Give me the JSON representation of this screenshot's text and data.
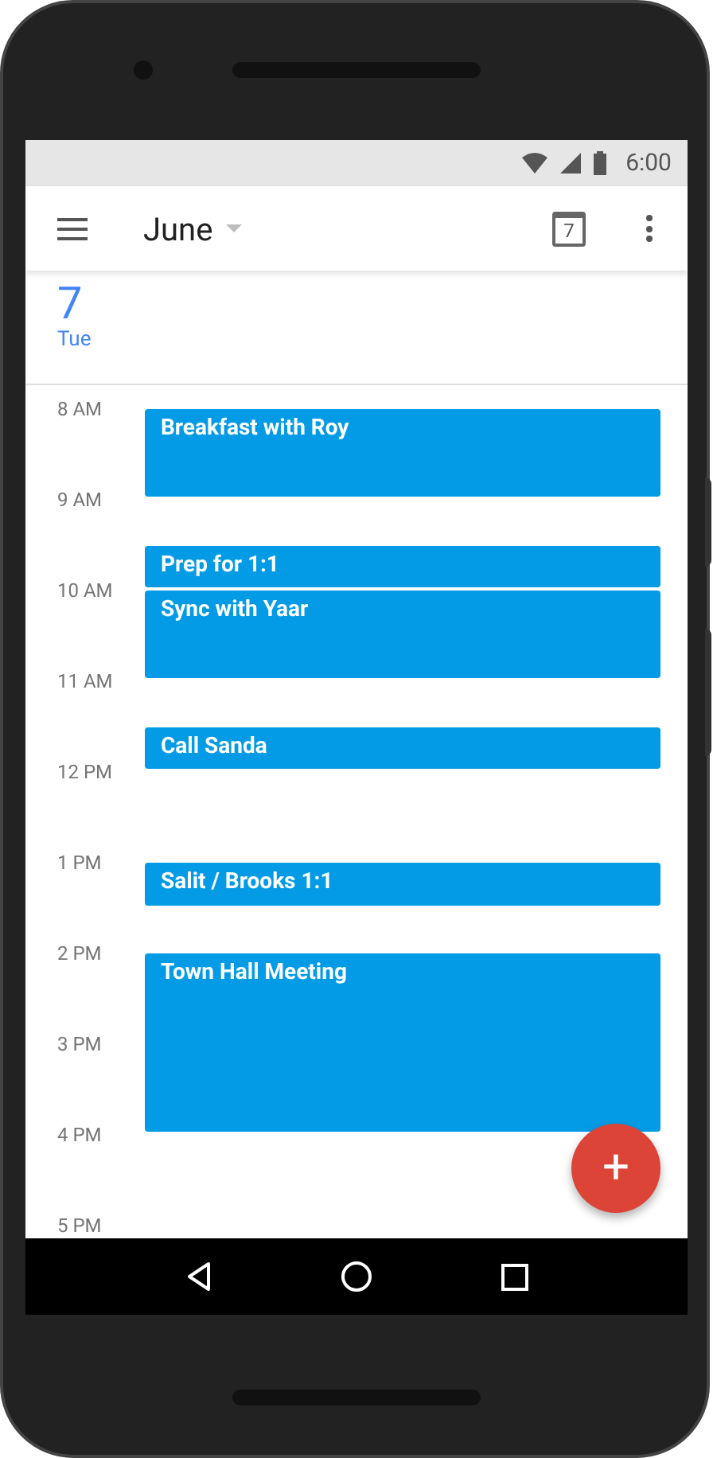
{
  "status_bar": {
    "time": "6:00"
  },
  "app_bar": {
    "title": "June"
  },
  "today_button": {
    "label": "7"
  },
  "day_header": {
    "date": "7",
    "weekday": "Tue"
  },
  "hours": [
    {
      "label": "8 AM",
      "events": [
        {
          "title": "Breakfast with Roy",
          "kind": "hour"
        }
      ]
    },
    {
      "label": "9 AM",
      "events": [
        {
          "title": "Prep for 1:1",
          "kind": "late-half"
        }
      ]
    },
    {
      "label": "10 AM",
      "events": [
        {
          "title": "Sync with Yaar",
          "kind": "hour"
        }
      ]
    },
    {
      "label": "11 AM",
      "events": [
        {
          "title": "Call Sanda",
          "kind": "late-half"
        }
      ]
    },
    {
      "label": "12 PM"
    },
    {
      "label": "1 PM",
      "events": [
        {
          "title": "Salit / Brooks 1:1",
          "kind": "half"
        }
      ]
    },
    {
      "label": "2 PM",
      "events": [
        {
          "title": "Town Hall Meeting",
          "kind": "two-hours"
        }
      ]
    },
    {
      "label": "3 PM"
    },
    {
      "label": "4 PM"
    },
    {
      "label": "5 PM"
    }
  ],
  "fab": {
    "label": "+"
  }
}
